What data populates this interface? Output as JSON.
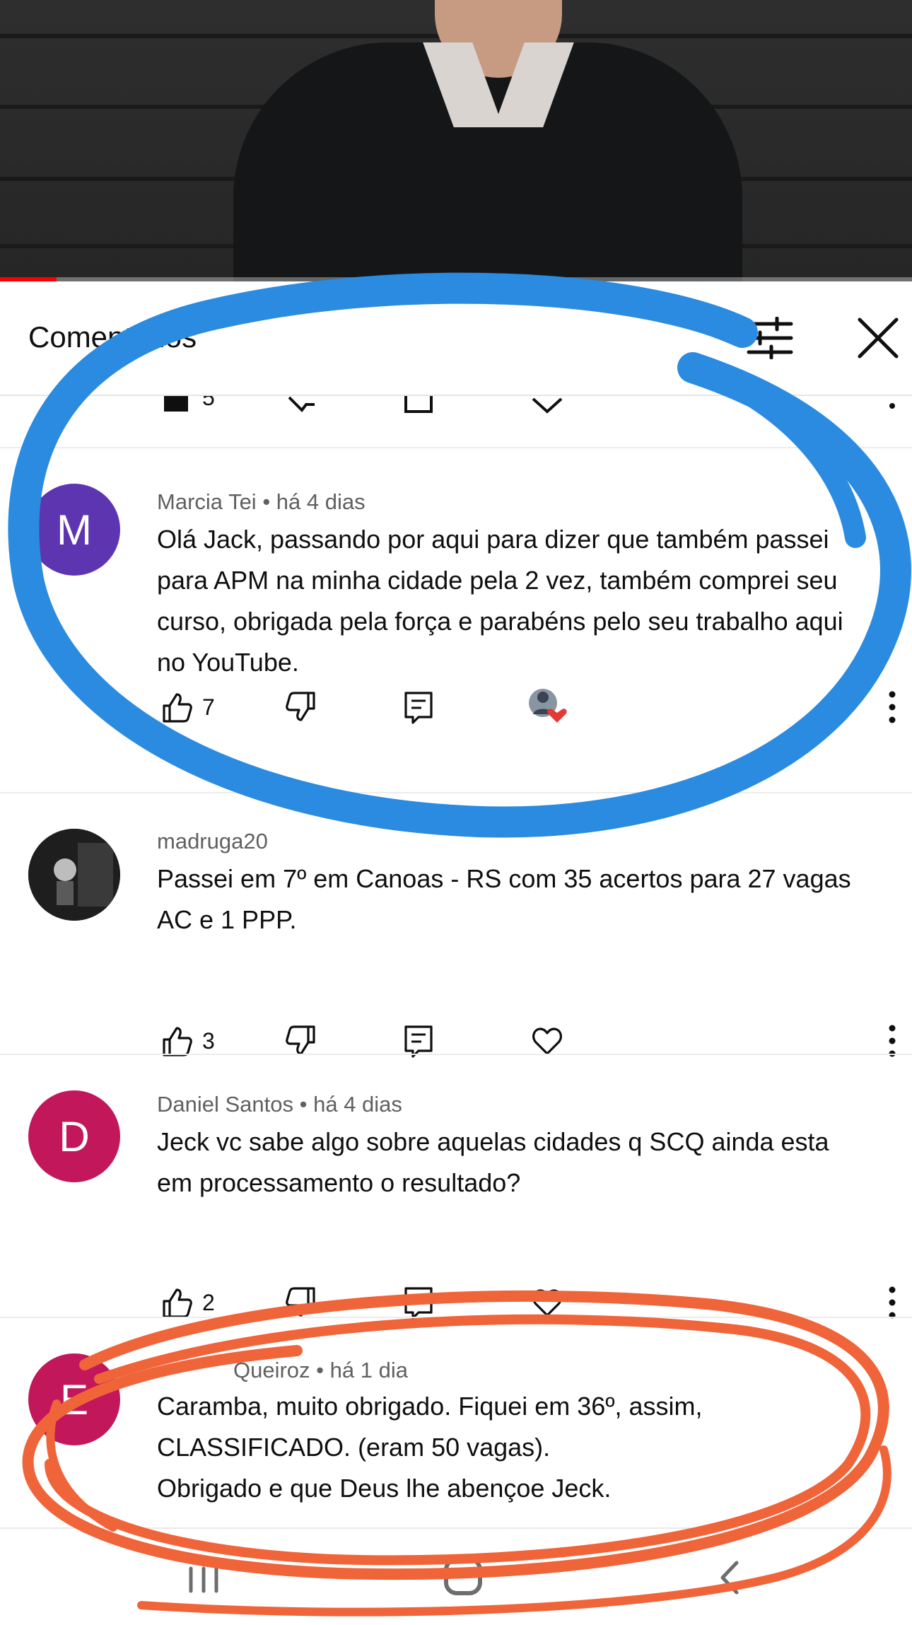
{
  "header": {
    "title": "Comentários"
  },
  "icons": {
    "filter": "sliders-icon",
    "close": "close-icon",
    "like": "thumbs-up-icon",
    "dislike": "thumbs-down-icon",
    "reply": "reply-icon",
    "heart": "heart-icon",
    "more": "more-vert-icon"
  },
  "previous": {
    "likes": "5"
  },
  "comments": [
    {
      "avatar_letter": "M",
      "avatar_color": "#5e35b1",
      "author": "Marcia Tei",
      "time": "há 4 dias",
      "text": "Olá Jack, passando por aqui para dizer que também passei para APM na minha cidade pela 2 vez, também comprei seu curso, obrigada pela força e parabéns pelo seu trabalho aqui no YouTube.",
      "likes": "7",
      "creator_hearted": true
    },
    {
      "avatar_letter": "",
      "avatar_color": "#2b2b2b",
      "author": "madruga20",
      "time": "",
      "text": "Passei em 7º em Canoas - RS com 35 acertos para 27 vagas AC e 1 PPP.",
      "likes": "3",
      "creator_hearted": false
    },
    {
      "avatar_letter": "D",
      "avatar_color": "#c2185b",
      "author": "Daniel Santos",
      "time": "há 4 dias",
      "text": "Jeck vc sabe algo sobre aquelas cidades q SCQ ainda esta em processamento o resultado?",
      "likes": "2",
      "creator_hearted": false
    },
    {
      "avatar_letter": "E",
      "avatar_color": "#c2185b",
      "author": "Queiroz",
      "time": "há 1 dia",
      "text_lines": [
        "Caramba, muito obrigado. Fiquei em 36º, assim,",
        "CLASSIFICADO. (eram 50 vagas).",
        "Obrigado e que Deus lhe abençoe Jeck."
      ]
    }
  ],
  "colors": {
    "annotation_blue": "#2a8be0",
    "annotation_orange": "#f0643a",
    "progress_red": "#ff0000"
  }
}
